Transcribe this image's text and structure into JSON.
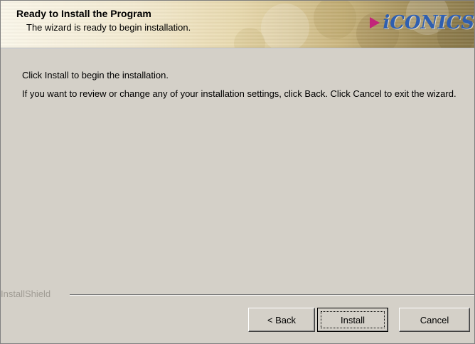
{
  "banner": {
    "title": "Ready to Install the Program",
    "subtitle": "The wizard is ready to begin installation.",
    "logo_text": "iCONICS",
    "logo_colors": {
      "text": "#2f5fb0",
      "play": "#c2257a"
    }
  },
  "body": {
    "line1": "Click Install to begin the installation.",
    "line2": "If you want to review or change any of your installation settings, click Back. Click Cancel to exit the wizard."
  },
  "footer": {
    "installshield_label": "InstallShield",
    "back_label": "< Back",
    "install_label": "Install",
    "cancel_label": "Cancel"
  }
}
